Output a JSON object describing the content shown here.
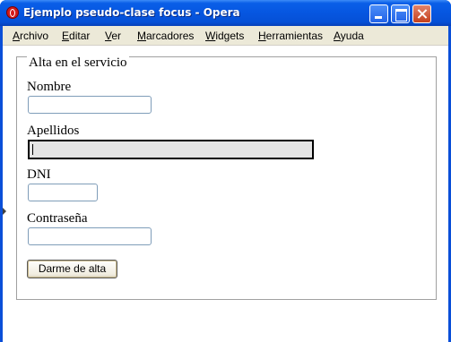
{
  "window": {
    "title": "Ejemplo pseudo-clase focus - Opera"
  },
  "menubar": {
    "items": [
      {
        "label": "Archivo"
      },
      {
        "label": "Editar"
      },
      {
        "label": "Ver"
      },
      {
        "label": "Marcadores"
      },
      {
        "label": "Widgets"
      },
      {
        "label": "Herramientas"
      },
      {
        "label": "Ayuda"
      }
    ]
  },
  "form": {
    "legend": "Alta en el servicio",
    "fields": [
      {
        "label": "Nombre",
        "value": "",
        "focused": false
      },
      {
        "label": "Apellidos",
        "value": "",
        "focused": true
      },
      {
        "label": "DNI",
        "value": "",
        "focused": false
      },
      {
        "label": "Contraseña",
        "value": "",
        "focused": false
      }
    ],
    "submit_label": "Darme de alta"
  },
  "colors": {
    "titlebar": "#0656e0",
    "menubar": "#ece9d8",
    "focused_input_bg": "#e4e4e4",
    "focused_input_border": "#000000"
  },
  "icons": [
    "opera-icon",
    "minimize-icon",
    "maximize-icon",
    "close-icon"
  ]
}
